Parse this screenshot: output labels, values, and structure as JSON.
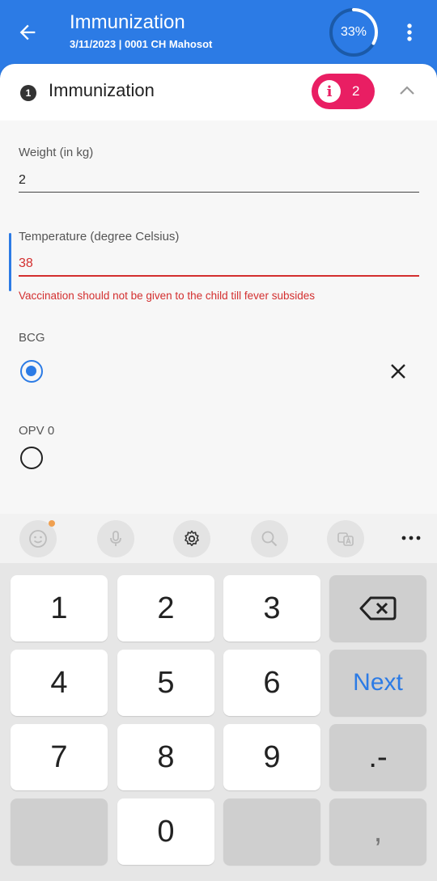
{
  "appbar": {
    "title": "Immunization",
    "subtitle": "3/11/2023 | 0001 CH Mahosot",
    "progress_label": "33%",
    "progress_fraction": 0.33,
    "accent_color": "#2c7be5"
  },
  "section": {
    "number": "1",
    "title": "Immunization",
    "error_count": "2",
    "error_color": "#e91e63"
  },
  "form": {
    "weight": {
      "label": "Weight (in kg)",
      "value": "2"
    },
    "temperature": {
      "label": "Temperature (degree Celsius)",
      "value": "38",
      "error": "Vaccination should not be given to the child till fever subsides"
    },
    "bcg": {
      "label": "BCG",
      "selected": true
    },
    "opv0": {
      "label": "OPV 0",
      "selected": false
    }
  },
  "keyboard": {
    "toolbar": [
      "emoji-icon",
      "microphone-icon",
      "gear-icon",
      "search-icon",
      "translate-icon",
      "more-icon"
    ],
    "keys": {
      "k1": "1",
      "k2": "2",
      "k3": "3",
      "k4": "4",
      "k5": "5",
      "k6": "6",
      "k7": "7",
      "k8": "8",
      "k9": "9",
      "k0": "0",
      "next": "Next",
      "dot_minus": ".-",
      "comma": ","
    }
  }
}
